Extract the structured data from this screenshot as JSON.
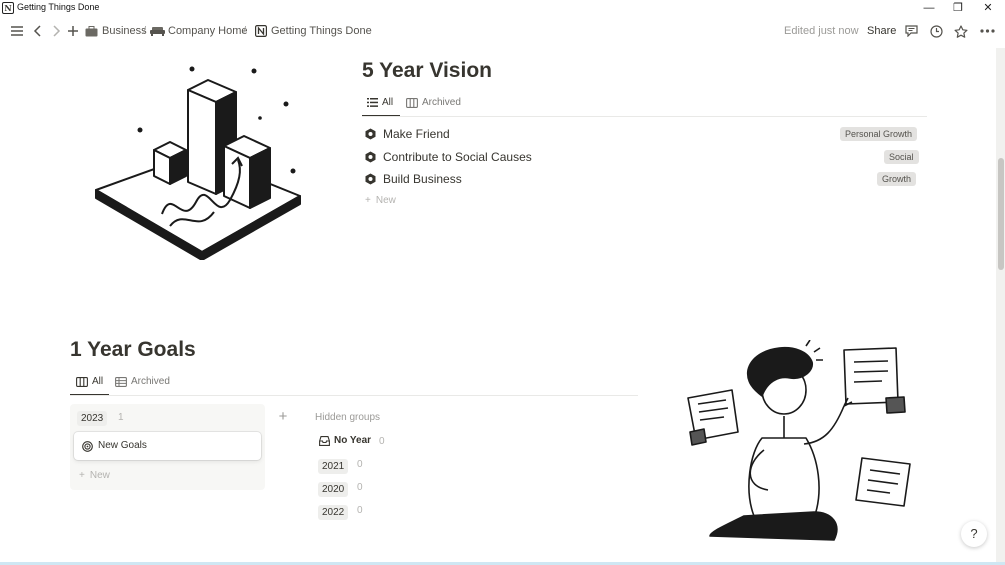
{
  "window": {
    "title": "Getting Things Done",
    "app_icon_glyph": "N",
    "controls": {
      "minimize": "—",
      "restore": "❐",
      "close": "✕"
    }
  },
  "topbar": {
    "breadcrumbs": [
      {
        "label": "Business",
        "icon": "briefcase-icon"
      },
      {
        "label": "Company Home",
        "icon": "sofa-icon"
      },
      {
        "label": "Getting Things Done",
        "icon": "notion-logo-icon"
      }
    ],
    "separator": "/",
    "edited": "Edited just now",
    "share": "Share",
    "icons": [
      "menu-icon",
      "back-icon",
      "forward-icon",
      "add-icon",
      "comments-icon",
      "updates-icon",
      "favorite-icon",
      "more-icon"
    ]
  },
  "vision": {
    "title": "5 Year Vision",
    "tabs": [
      {
        "label": "All",
        "icon": "list-icon",
        "active": true
      },
      {
        "label": "Archived",
        "icon": "board-icon",
        "active": false
      }
    ],
    "rows": [
      {
        "title": "Make Friend",
        "tag": "Personal Growth"
      },
      {
        "title": "Contribute to Social Causes",
        "tag": "Social"
      },
      {
        "title": "Build Business",
        "tag": "Growth"
      }
    ],
    "new_label": "New"
  },
  "goals": {
    "title": "1 Year Goals",
    "tabs": [
      {
        "label": "All",
        "icon": "board-icon",
        "active": true
      },
      {
        "label": "Archived",
        "icon": "table-icon",
        "active": false
      }
    ],
    "column": {
      "label": "2023",
      "count": "1"
    },
    "card": {
      "title": "New Goals",
      "icon": "target-icon"
    },
    "new_label": "New",
    "add_group": "+",
    "hidden_groups_label": "Hidden groups",
    "hidden_groups": [
      {
        "label": "No Year",
        "count": "0",
        "icon": "inbox-icon"
      },
      {
        "label": "2021",
        "count": "0"
      },
      {
        "label": "2020",
        "count": "0"
      },
      {
        "label": "2022",
        "count": "0"
      }
    ]
  },
  "help": "?",
  "colors": {
    "text": "#37352f",
    "muted": "#9b9a97",
    "tag_bg": "#e3e2e0",
    "divider": "#e9e9e7"
  }
}
